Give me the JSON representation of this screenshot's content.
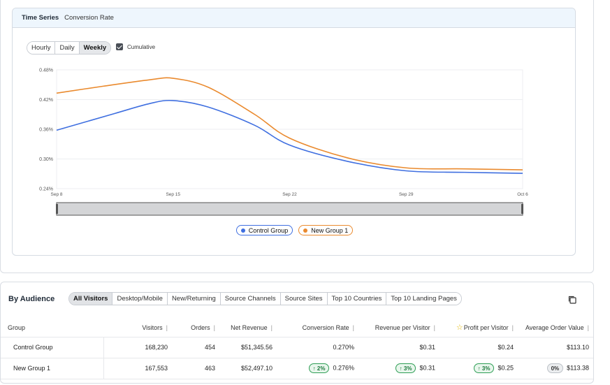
{
  "time_series": {
    "title": "Time Series",
    "metric": "Conversion Rate",
    "granularity": [
      {
        "label": "Hourly",
        "active": false
      },
      {
        "label": "Daily",
        "active": false
      },
      {
        "label": "Weekly",
        "active": true
      }
    ],
    "cumulative_label": "Cumulative",
    "cumulative_checked": true
  },
  "chart_data": {
    "type": "line",
    "x": [
      "Sep 8",
      "Sep 15",
      "Sep 22",
      "Sep 29",
      "Oct 6"
    ],
    "y_ticks": [
      "0.48%",
      "0.42%",
      "0.36%",
      "0.30%",
      "0.24%"
    ],
    "ylim": [
      0.24,
      0.48
    ],
    "grid": true,
    "legend_position": "bottom-center",
    "series": [
      {
        "name": "Control Group",
        "color": "#3f6fe0",
        "points": [
          [
            0,
            0.358
          ],
          [
            0.5,
            0.392
          ],
          [
            0.8,
            0.412
          ],
          [
            1,
            0.418
          ],
          [
            1.3,
            0.405
          ],
          [
            1.7,
            0.368
          ],
          [
            2,
            0.328
          ],
          [
            2.5,
            0.295
          ],
          [
            3,
            0.276
          ],
          [
            3.5,
            0.273
          ],
          [
            4,
            0.271
          ]
        ]
      },
      {
        "name": "New Group 1",
        "color": "#ea8a2e",
        "points": [
          [
            0,
            0.433
          ],
          [
            0.4,
            0.447
          ],
          [
            0.8,
            0.46
          ],
          [
            1,
            0.463
          ],
          [
            1.3,
            0.445
          ],
          [
            1.7,
            0.39
          ],
          [
            2,
            0.342
          ],
          [
            2.5,
            0.302
          ],
          [
            3,
            0.282
          ],
          [
            3.5,
            0.28
          ],
          [
            4,
            0.278
          ]
        ]
      }
    ]
  },
  "audience": {
    "title": "By Audience",
    "tabs": [
      {
        "label": "All Visitors",
        "active": true
      },
      {
        "label": "Desktop/Mobile",
        "active": false
      },
      {
        "label": "New/Returning",
        "active": false
      },
      {
        "label": "Source Channels",
        "active": false
      },
      {
        "label": "Source Sites",
        "active": false
      },
      {
        "label": "Top 10 Countries",
        "active": false
      },
      {
        "label": "Top 10 Landing Pages",
        "active": false
      }
    ],
    "columns": [
      "Group",
      "Visitors",
      "Orders",
      "Net Revenue",
      "Conversion Rate",
      "Revenue per Visitor",
      "Profit per Visitor",
      "Average Order Value"
    ],
    "rows": [
      {
        "group": "Control Group",
        "visitors": "168,230",
        "orders": "454",
        "net_revenue": "$51,345.56",
        "conversion_rate": "0.270%",
        "conversion_badge": "",
        "rpv": "$0.31",
        "rpv_badge": "",
        "ppv": "$0.24",
        "ppv_badge": "",
        "aov": "$113.10",
        "aov_badge": ""
      },
      {
        "group": "New Group 1",
        "visitors": "167,553",
        "orders": "463",
        "net_revenue": "$52,497.10",
        "conversion_rate": "0.276%",
        "conversion_badge": "2%",
        "rpv": "$0.31",
        "rpv_badge": "3%",
        "ppv": "$0.25",
        "ppv_badge": "3%",
        "aov": "$113.38",
        "aov_badge": "0%"
      }
    ]
  },
  "colors": {
    "control": "#3f6fe0",
    "new_group": "#ea8a2e",
    "positive": "#2e9e55"
  }
}
